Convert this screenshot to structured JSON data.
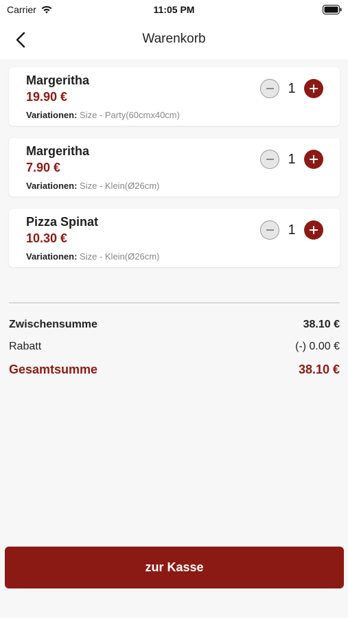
{
  "status": {
    "carrier": "Carrier",
    "time": "11:05 PM"
  },
  "nav": {
    "title": "Warenkorb"
  },
  "items": [
    {
      "name": "Margeritha",
      "price": "19.90 €",
      "variations_label": "Variationen:",
      "variations": "Size - Party(60cmx40cm)",
      "quantity": "1"
    },
    {
      "name": "Margeritha",
      "price": "7.90 €",
      "variations_label": "Variationen:",
      "variations": "Size - Klein(Ø26cm)",
      "quantity": "1"
    },
    {
      "name": "Pizza Spinat",
      "price": "10.30 €",
      "variations_label": "Variationen:",
      "variations": "Size - Klein(Ø26cm)",
      "quantity": "1"
    }
  ],
  "summary": {
    "subtotal_label": "Zwischensumme",
    "subtotal_value": "38.10 €",
    "discount_label": "Rabatt",
    "discount_value": "(-) 0.00 €",
    "total_label": "Gesamtsumme",
    "total_value": "38.10 €"
  },
  "checkout": {
    "label": "zur Kasse"
  },
  "colors": {
    "accent": "#8b1a14",
    "background": "#f7f7f7"
  },
  "icons": {
    "back": "chevron-left-icon",
    "minus": "minus-circle-icon",
    "plus": "plus-circle-icon",
    "wifi": "wifi-icon",
    "battery": "battery-icon"
  }
}
